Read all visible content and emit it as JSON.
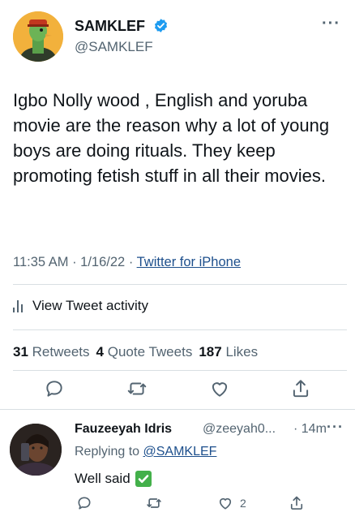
{
  "tweet": {
    "author_name": "SAMKLEF",
    "author_handle": "@SAMKLEF",
    "more_label": "···",
    "text": "Igbo Nolly wood , English and yoruba movie are the reason why a lot of young boys are doing rituals. They keep promoting fetish stuff in all their movies.",
    "time": "11:35 AM",
    "date": "1/16/22",
    "separator": " · ",
    "source": "Twitter for iPhone",
    "activity_label": "View Tweet activity",
    "retweets_count": "31",
    "retweets_label": "Retweets",
    "quotes_count": "4",
    "quotes_label": "Quote Tweets",
    "likes_count": "187",
    "likes_label": "Likes"
  },
  "reply": {
    "name": "Fauzeeyah Idris",
    "handle": "@zeeyah0...",
    "time": "· 14m",
    "more_label": "···",
    "replying_prefix": "Replying to ",
    "replying_to": "@SAMKLEF",
    "text": "Well said",
    "likes_count": "2"
  },
  "colors": {
    "accent": "#1d9bf0",
    "link": "#1d4f8c",
    "secondary_text": "#536471",
    "divider": "#d9dfe3",
    "check_green": "#43b04a"
  },
  "icons": [
    "verified-badge-icon",
    "more-icon",
    "activity-bars-icon",
    "reply-icon",
    "retweet-icon",
    "like-icon",
    "share-icon",
    "check-mark-emoji"
  ]
}
